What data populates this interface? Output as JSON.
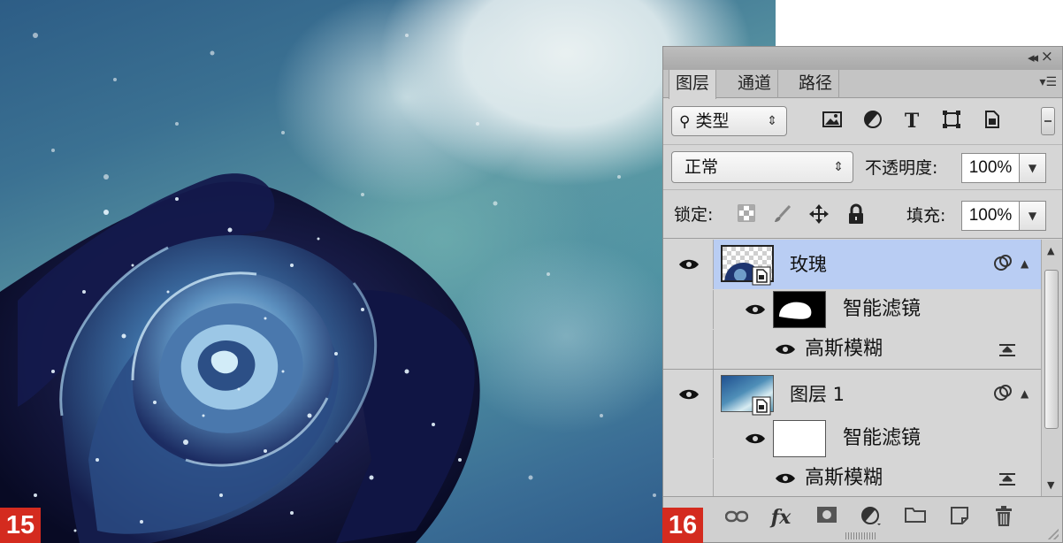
{
  "figures": {
    "left_number": "15",
    "right_number": "16"
  },
  "panel": {
    "tabs": [
      {
        "label": "图层",
        "active": true
      },
      {
        "label": "通道",
        "active": false
      },
      {
        "label": "路径",
        "active": false
      }
    ],
    "filter": {
      "label": "类型",
      "icons": [
        "image-filter-icon",
        "adjustment-filter-icon",
        "type-filter-icon",
        "shape-filter-icon",
        "smart-object-filter-icon"
      ]
    },
    "blend_mode": "正常",
    "opacity_label": "不透明度:",
    "opacity_value": "100%",
    "lock_label": "锁定:",
    "lock_icons": [
      "lock-transparent-icon",
      "lock-image-icon",
      "lock-position-icon",
      "lock-all-icon"
    ],
    "fill_label": "填充:",
    "fill_value": "100%",
    "layers": [
      {
        "name": "玫瑰",
        "selected": true,
        "smart_filters_label": "智能滤镜",
        "filter_name": "高斯模糊",
        "mask": "black-with-white-blob"
      },
      {
        "name": "图层 1",
        "selected": false,
        "smart_filters_label": "智能滤镜",
        "filter_name": "高斯模糊",
        "mask": "white"
      }
    ],
    "bottom_icons": [
      "link-layers-icon",
      "fx-icon",
      "mask-icon",
      "adjustment-layer-icon",
      "group-folder-icon",
      "new-layer-icon",
      "trash-icon"
    ],
    "fx_label": "fx"
  },
  "colors": {
    "selection": "#b9cdf3",
    "badge": "#d42b1f",
    "panel_bg": "#d6d6d6"
  }
}
